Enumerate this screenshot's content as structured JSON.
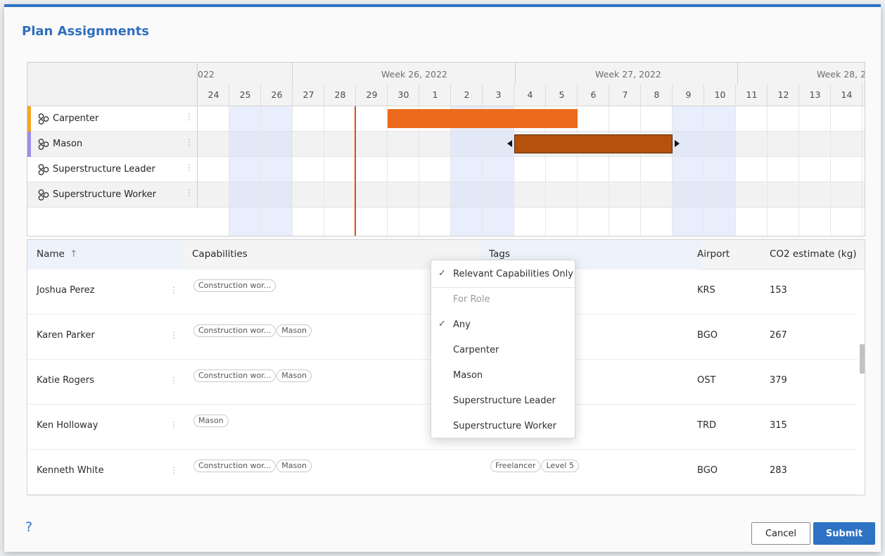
{
  "dialog": {
    "title": "Plan Assignments"
  },
  "gantt": {
    "weeks": [
      {
        "label": "022"
      },
      {
        "label": "Week 26, 2022"
      },
      {
        "label": "Week 27, 2022"
      },
      {
        "label": "Week 28, 2"
      }
    ],
    "days": [
      "24",
      "25",
      "26",
      "27",
      "28",
      "29",
      "30",
      "1",
      "2",
      "3",
      "4",
      "5",
      "6",
      "7",
      "8",
      "9",
      "10",
      "11",
      "12",
      "13",
      "14"
    ],
    "weekend_days": [
      "25",
      "26",
      "2",
      "3",
      "9",
      "10"
    ],
    "roles": [
      {
        "name": "Carpenter",
        "color": "#f5a623"
      },
      {
        "name": "Mason",
        "color": "#9b8fe6"
      },
      {
        "name": "Superstructure Leader",
        "color": ""
      },
      {
        "name": "Superstructure Worker",
        "color": ""
      }
    ],
    "assignments": [
      {
        "role": "Carpenter",
        "start": "30",
        "end": "5",
        "color": "#eb6a1c"
      },
      {
        "role": "Mason",
        "start": "4",
        "end": "8",
        "color": "#b5510e",
        "selected": true
      }
    ],
    "today_day": "29",
    "today_color": "#e8431b"
  },
  "table": {
    "columns": {
      "name": "Name",
      "sort_icon": "↑",
      "capabilities": "Capabilities",
      "tags": "Tags",
      "airport": "Airport",
      "co2": "CO2 estimate (kg)"
    },
    "rows": [
      {
        "name": "Joshua Perez",
        "capabilities": [
          "Construction wor..."
        ],
        "tags": [],
        "airport": "KRS",
        "co2": "153"
      },
      {
        "name": "Karen Parker",
        "capabilities": [
          "Construction wor...",
          "Mason"
        ],
        "tags": [],
        "airport": "BGO",
        "co2": "267"
      },
      {
        "name": "Katie Rogers",
        "capabilities": [
          "Construction wor...",
          "Mason"
        ],
        "tags": [],
        "airport": "OST",
        "co2": "379"
      },
      {
        "name": "Ken Holloway",
        "capabilities": [
          "Mason"
        ],
        "tags": [],
        "airport": "TRD",
        "co2": "315"
      },
      {
        "name": "Kenneth White",
        "capabilities": [
          "Construction wor...",
          "Mason"
        ],
        "tags": [
          "Freelancer",
          "Level 5"
        ],
        "airport": "BGO",
        "co2": "283"
      }
    ]
  },
  "dropdown": {
    "items": [
      {
        "label": "Relevant Capabilities Only",
        "checked": true
      },
      {
        "label": "For Role",
        "header": true
      },
      {
        "label": "Any",
        "checked": true
      },
      {
        "label": "Carpenter",
        "checked": false
      },
      {
        "label": "Mason",
        "checked": false
      },
      {
        "label": "Superstructure Leader",
        "checked": false
      },
      {
        "label": "Superstructure Worker",
        "checked": false
      }
    ],
    "check_glyph": "✓"
  },
  "footer": {
    "help": "?",
    "cancel": "Cancel",
    "submit": "Submit"
  }
}
